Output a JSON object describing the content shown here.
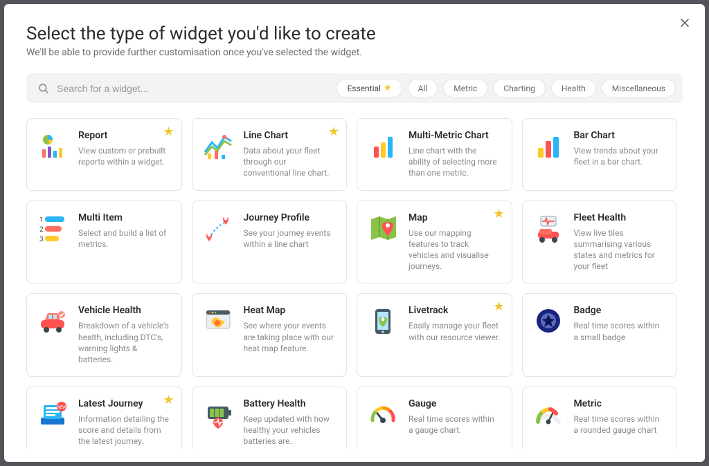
{
  "header": {
    "title": "Select the type of widget you'd like to create",
    "subtitle": "We'll be able to provide further customisation once you've selected the widget."
  },
  "search": {
    "placeholder": "Search for a widget..."
  },
  "filters": [
    {
      "label": "Essential",
      "star": true,
      "active": true
    },
    {
      "label": "All",
      "star": false,
      "active": false
    },
    {
      "label": "Metric",
      "star": false,
      "active": false
    },
    {
      "label": "Charting",
      "star": false,
      "active": false
    },
    {
      "label": "Health",
      "star": false,
      "active": false
    },
    {
      "label": "Miscellaneous",
      "star": false,
      "active": false
    }
  ],
  "cards": [
    {
      "title": "Report",
      "desc": "View custom or prebuilt reports within a widget.",
      "star": true,
      "icon": "report"
    },
    {
      "title": "Line Chart",
      "desc": "Data about your fleet through our conventional line chart.",
      "star": true,
      "icon": "line-chart"
    },
    {
      "title": "Multi-Metric Chart",
      "desc": "Line chart with the ability of selecting more than one metric.",
      "star": false,
      "icon": "multi-metric"
    },
    {
      "title": "Bar Chart",
      "desc": "View trends about your fleet in a bar chart.",
      "star": false,
      "icon": "bar-chart"
    },
    {
      "title": "Multi Item",
      "desc": "Select and build a list of metrics.",
      "star": false,
      "icon": "multi-item"
    },
    {
      "title": "Journey Profile",
      "desc": "See your journey events within a line chart",
      "star": false,
      "icon": "journey"
    },
    {
      "title": "Map",
      "desc": "Use our mapping features to track vehicles and visualise journeys.",
      "star": true,
      "icon": "map"
    },
    {
      "title": "Fleet Health",
      "desc": "View live tiles summarising various states and metrics for your fleet",
      "star": false,
      "icon": "fleet-health"
    },
    {
      "title": "Vehicle Health",
      "desc": "Breakdown of a vehicle's health, including DTC's, warning lights & batteries.",
      "star": false,
      "icon": "vehicle"
    },
    {
      "title": "Heat Map",
      "desc": "See where your events are taking place with our heat map feature.",
      "star": false,
      "icon": "heatmap"
    },
    {
      "title": "Livetrack",
      "desc": "Easily manage your fleet with our resource viewer.",
      "star": true,
      "icon": "livetrack"
    },
    {
      "title": "Badge",
      "desc": "Real time scores within a small badge",
      "star": false,
      "icon": "badge"
    },
    {
      "title": "Latest Journey",
      "desc": "Information detailing the score and details from the latest journey.",
      "star": true,
      "icon": "latest-journey"
    },
    {
      "title": "Battery Health",
      "desc": "Keep updated with how healthy your vehicles batteries are.",
      "star": false,
      "icon": "battery"
    },
    {
      "title": "Gauge",
      "desc": "Real time scores within a gauge chart.",
      "star": false,
      "icon": "gauge"
    },
    {
      "title": "Metric",
      "desc": "Real time scores within a rounded gauge chart",
      "star": false,
      "icon": "metric"
    }
  ]
}
